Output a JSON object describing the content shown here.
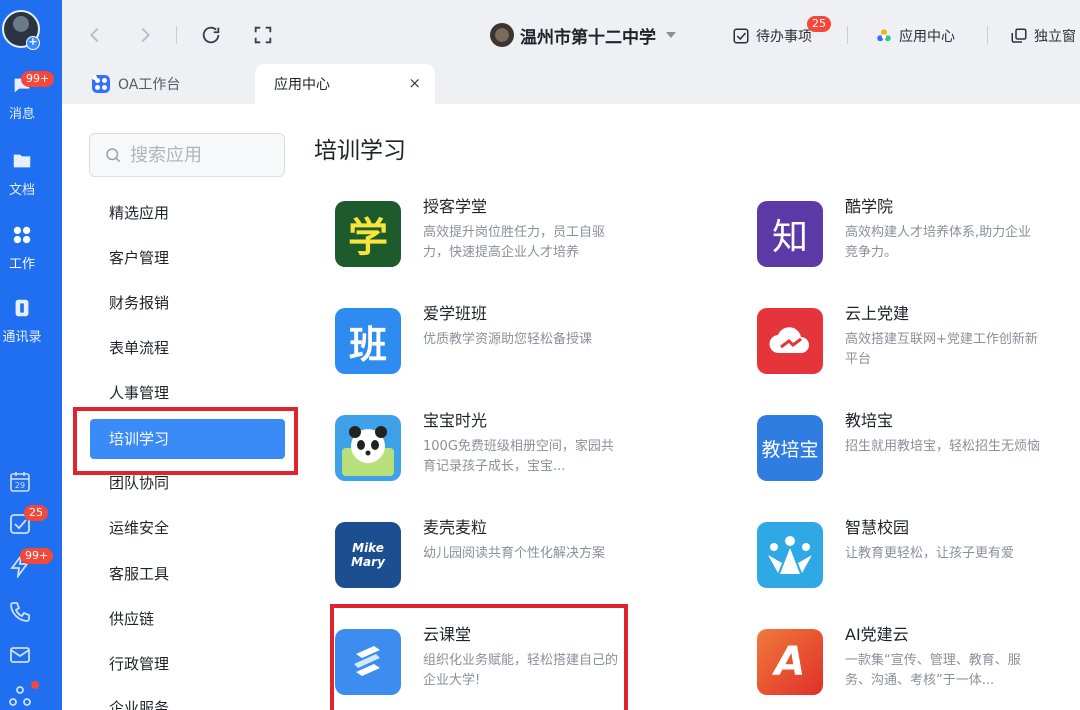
{
  "rail": {
    "items": [
      {
        "label": "消息",
        "badge": "99+"
      },
      {
        "label": "文档"
      },
      {
        "label": "工作"
      },
      {
        "label": "通讯录"
      }
    ],
    "lower_badges": {
      "todo": "25",
      "notify": "99+"
    }
  },
  "topbar": {
    "school_name": "温州市第十二中学",
    "todo_label": "待办事项",
    "todo_badge": "25",
    "app_center_label": "应用中心",
    "window_label": "独立窗"
  },
  "tabs": [
    {
      "label": "OA工作台"
    },
    {
      "label": "应用中心",
      "close": "×"
    }
  ],
  "search": {
    "placeholder": "搜索应用"
  },
  "categories": [
    "精选应用",
    "客户管理",
    "财务报销",
    "表单流程",
    "人事管理",
    "培训学习",
    "团队协同",
    "运维安全",
    "客服工具",
    "供应链",
    "行政管理",
    "企业服务"
  ],
  "active_category": "培训学习",
  "section": {
    "title": "培训学习"
  },
  "apps": [
    {
      "name": "授客学堂",
      "desc": "高效提升岗位胜任力，员工自驱力，快速提高企业人才培养",
      "icon_text": "学",
      "icon_color": "#1d5a2c"
    },
    {
      "name": "酷学院",
      "desc": "高效构建人才培养体系,助力企业竞争力。",
      "icon_text": "知",
      "icon_color": "#5b3aa8"
    },
    {
      "name": "爱学班班",
      "desc": "优质教学资源助您轻松备授课",
      "icon_text": "班",
      "icon_color": "#2e8cf0"
    },
    {
      "name": "云上党建",
      "desc": "高效搭建互联网+党建工作创新新平台",
      "icon_text": "",
      "icon_color": "#e5343a"
    },
    {
      "name": "宝宝时光",
      "desc": "100G免费班级相册空间，家园共育记录孩子成长，宝宝...",
      "icon_text": "",
      "icon_color": "#3fa2e8"
    },
    {
      "name": "教培宝",
      "desc": "招生就用教培宝，轻松招生无烦恼",
      "icon_text": "教培宝",
      "icon_color": "#2f7de1"
    },
    {
      "name": "麦壳麦粒",
      "desc": "幼儿园阅读共育个性化解决方案",
      "icon_text": "Mike Mary",
      "icon_color": "#1c4f8f"
    },
    {
      "name": "智慧校园",
      "desc": "让教育更轻松，让孩子更有爱",
      "icon_text": "",
      "icon_color": "#2fa8e6"
    },
    {
      "name": "云课堂",
      "desc": "组织化业务赋能，轻松搭建自己的企业大学!",
      "icon_text": "",
      "icon_color": "#3d8cf0"
    },
    {
      "name": "AI党建云",
      "desc": "一款集“宣传、管理、教育、服务、沟通、考核”于一体...",
      "icon_text": "A",
      "icon_color": "#e8452c"
    }
  ]
}
